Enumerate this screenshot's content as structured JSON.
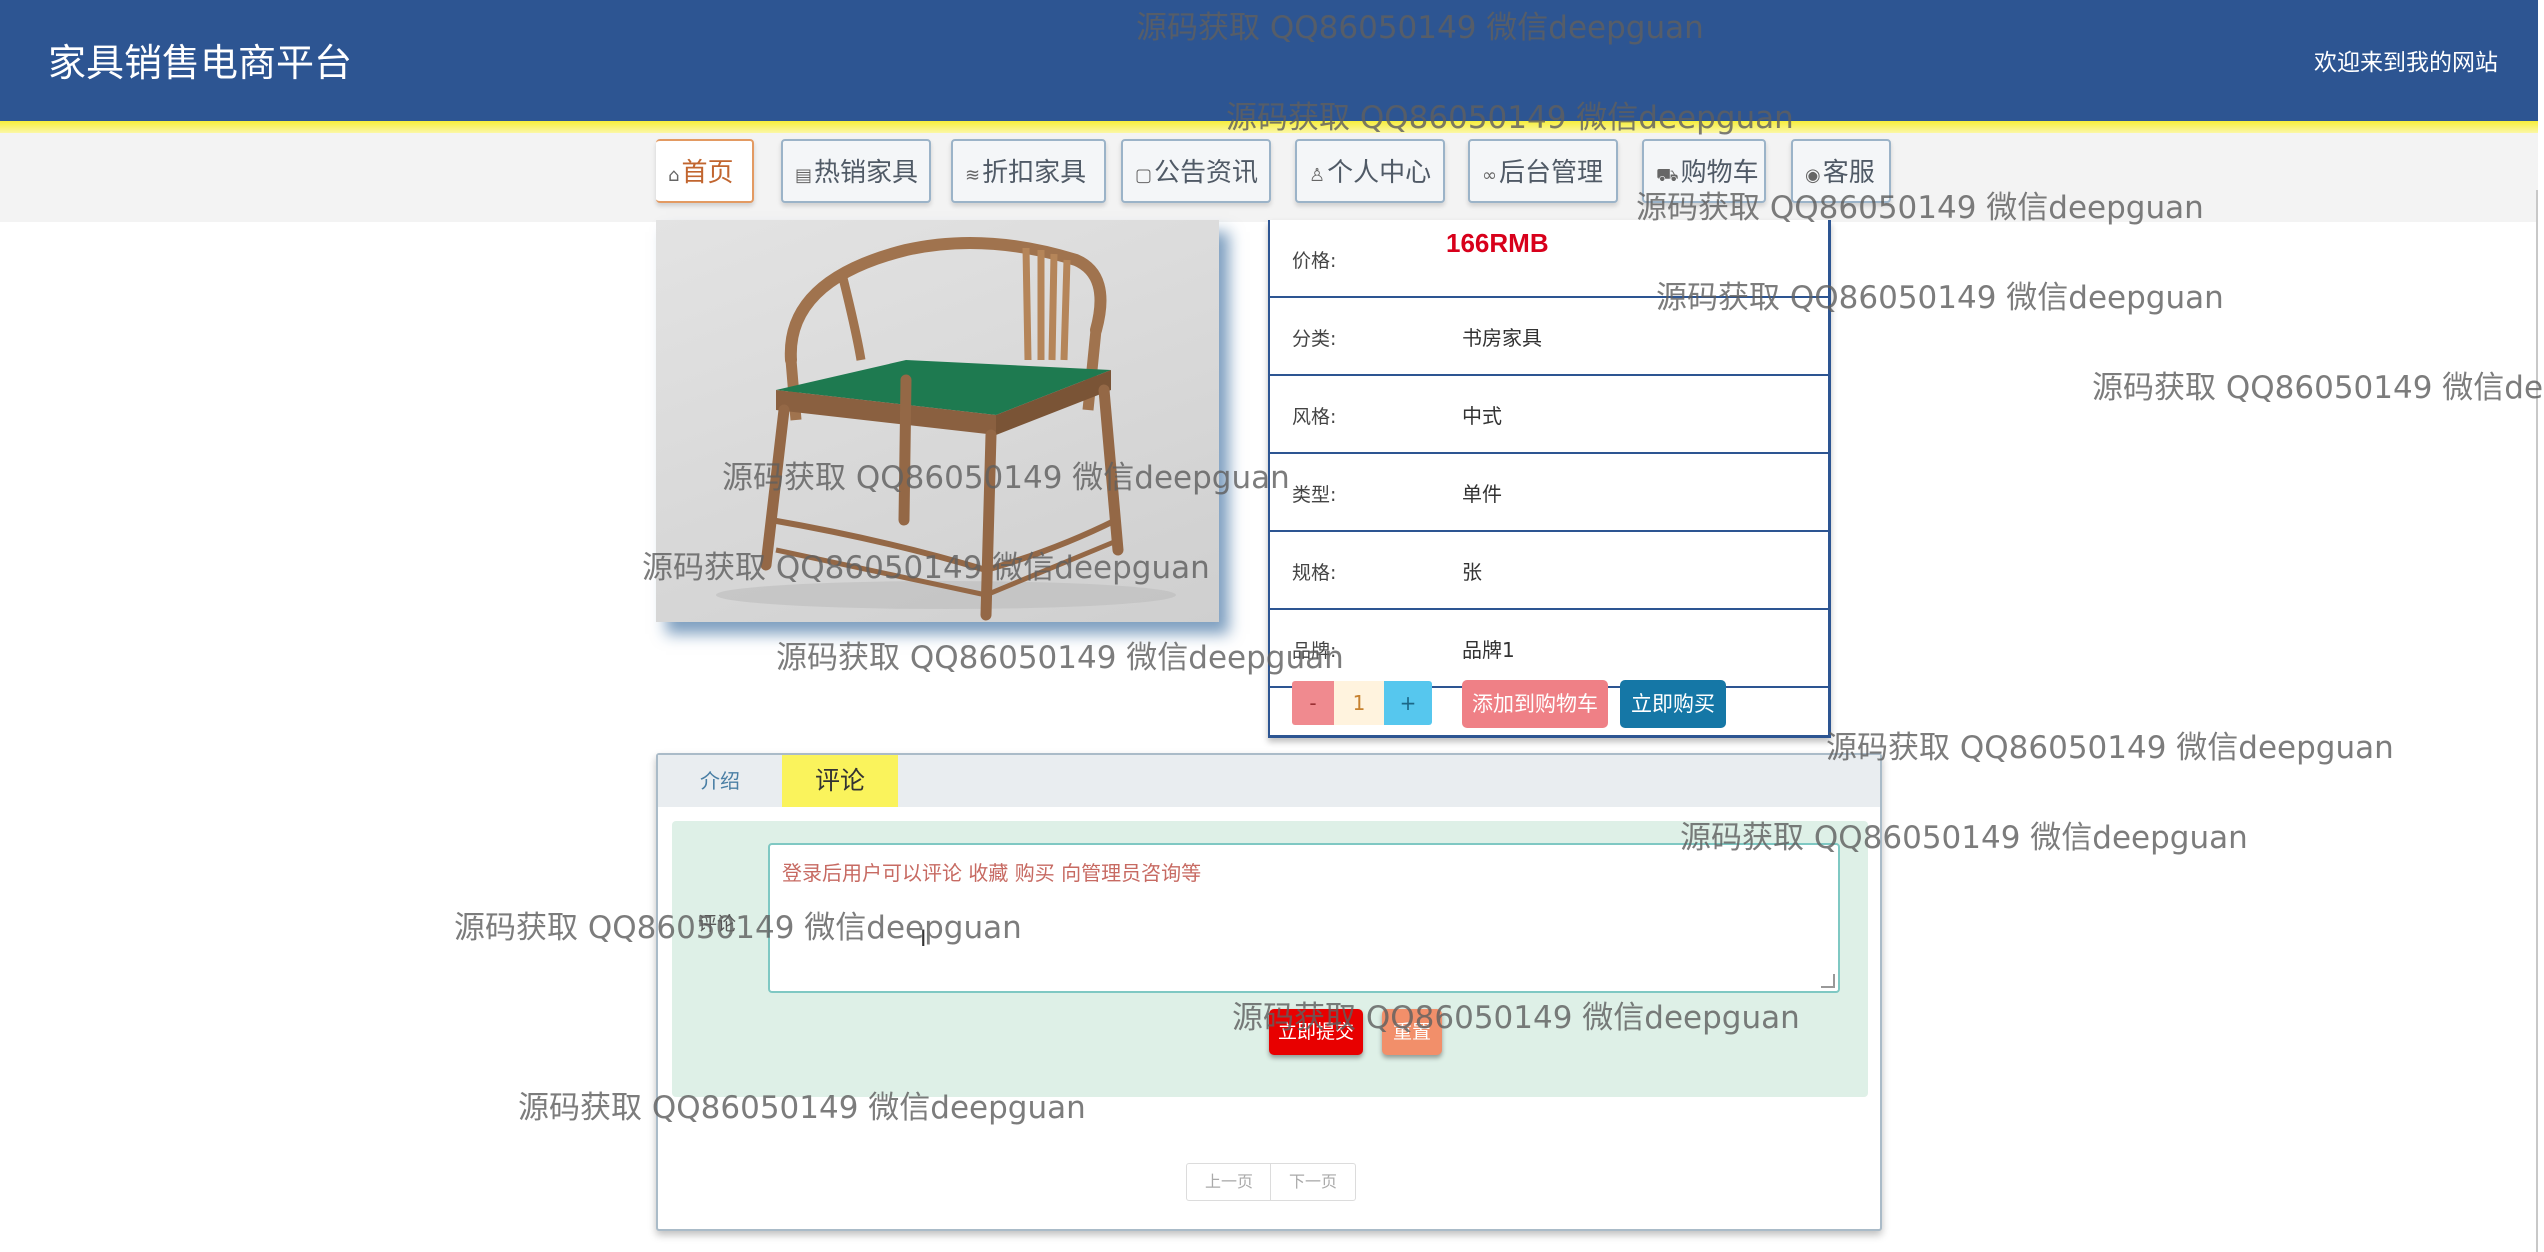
{
  "header": {
    "title": "家具销售电商平台",
    "welcome": "欢迎来到我的网站"
  },
  "nav": [
    {
      "label": "首页",
      "icon": "home-icon",
      "glyph": "⌂"
    },
    {
      "label": "热销家具",
      "icon": "product-icon",
      "glyph": "▤"
    },
    {
      "label": "折扣家具",
      "icon": "layers-icon",
      "glyph": "≋"
    },
    {
      "label": "公告资讯",
      "icon": "note-icon",
      "glyph": "▢"
    },
    {
      "label": "个人中心",
      "icon": "user-icon",
      "glyph": "♙"
    },
    {
      "label": "后台管理",
      "icon": "link-icon",
      "glyph": "∞"
    },
    {
      "label": "购物车",
      "icon": "cart-icon",
      "glyph": "⛟"
    },
    {
      "label": "客服",
      "icon": "chat-icon",
      "glyph": "◉"
    }
  ],
  "product": {
    "price_label": "价格:",
    "price": "166RMB",
    "category_label": "分类:",
    "category": "书房家具",
    "style_label": "风格:",
    "style": "中式",
    "type_label": "类型:",
    "type": "单件",
    "spec_label": "规格:",
    "spec": "张",
    "brand_label": "品牌:",
    "brand": "品牌1",
    "qty_minus": "-",
    "qty": "1",
    "qty_plus": "+",
    "add_cart": "添加到购物车",
    "buy_now": "立即购买"
  },
  "tabs": {
    "intro": "介绍",
    "comment": "评论"
  },
  "comment": {
    "label": "评论",
    "placeholder": "登录后用户可以评论  收藏  购买  向管理员咨询等",
    "caret": "I",
    "submit": "立即提交",
    "reset": "重置"
  },
  "pager": {
    "prev": "上一页",
    "next": "下一页"
  },
  "watermark": "源码获取 QQ86050149 微信deepguan",
  "colors": {
    "header_bg": "#2d5592",
    "accent_yellow": "#faf35c",
    "price_red": "#d8001b",
    "buy_blue": "#1577a6"
  }
}
